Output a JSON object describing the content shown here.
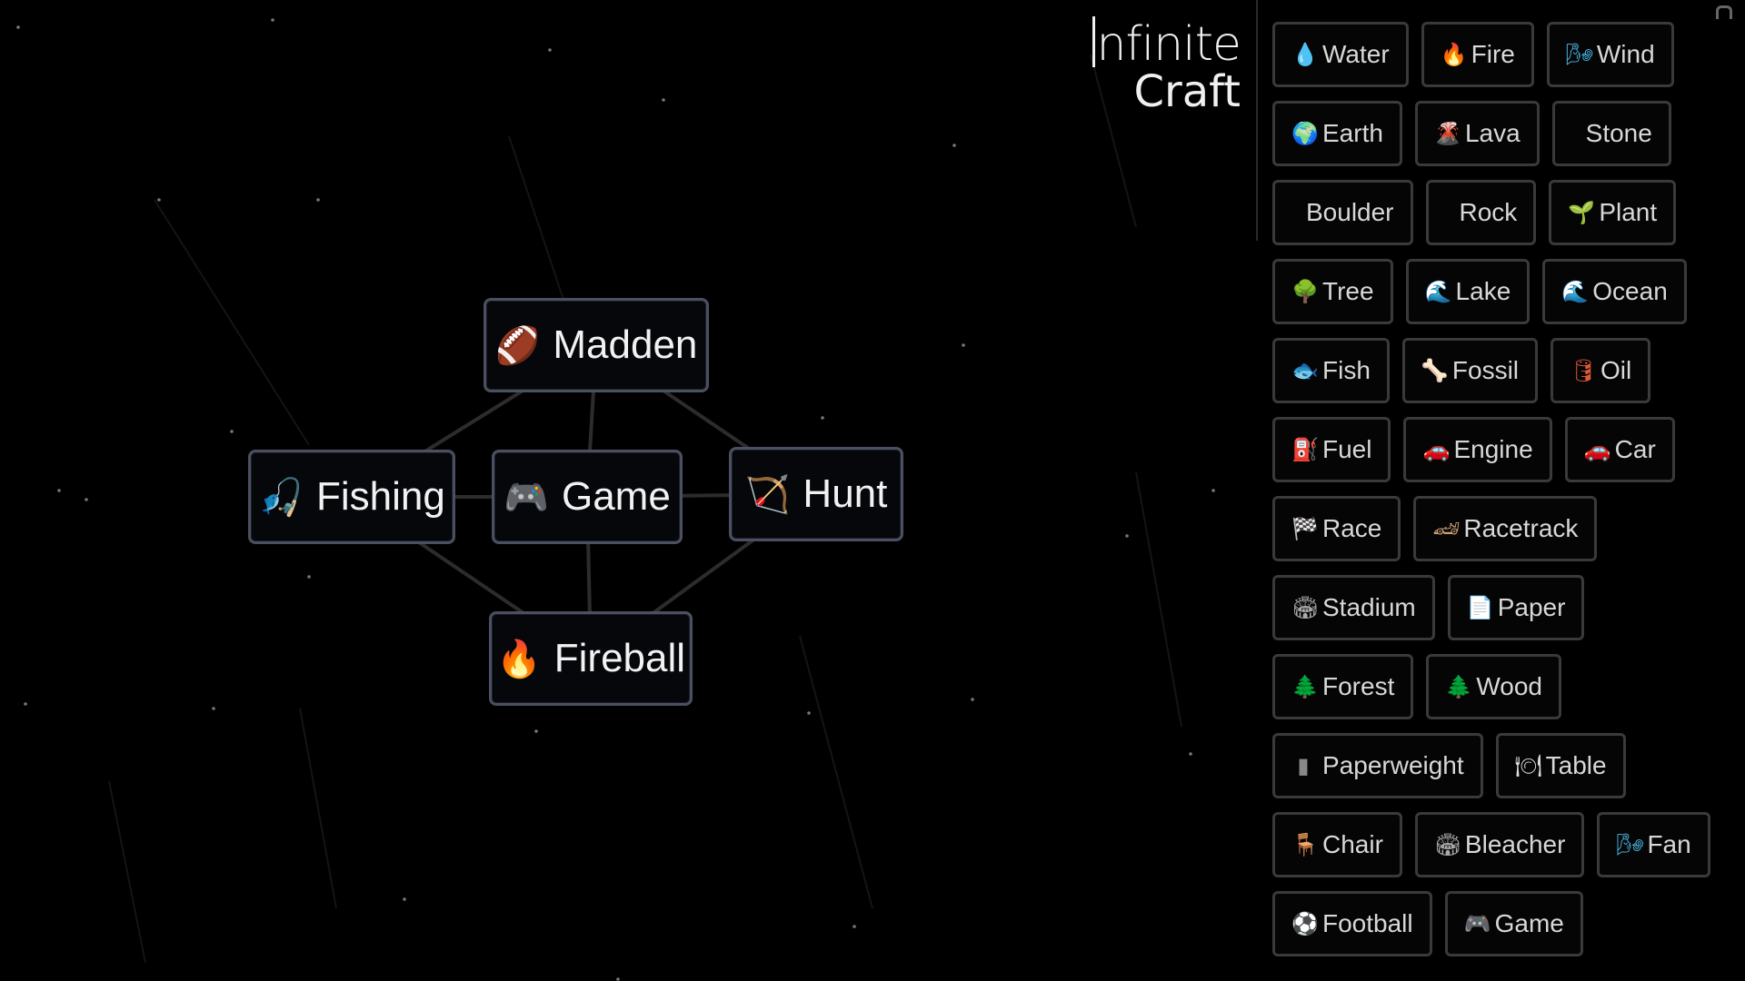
{
  "logo": {
    "line1": "nfinite",
    "line2": "Craft"
  },
  "canvas": {
    "nodes": [
      {
        "id": "madden",
        "label": "Madden",
        "icon": "football-icon",
        "glyph": "🏈",
        "color": "#8a4a24"
      },
      {
        "id": "fishing",
        "label": "Fishing",
        "icon": "fishing-pole-icon",
        "glyph": "🎣",
        "color": "#3aa0e0"
      },
      {
        "id": "game",
        "label": "Game",
        "icon": "gamepad-icon",
        "glyph": "🎮",
        "color": "#555555"
      },
      {
        "id": "hunt",
        "label": "Hunt",
        "icon": "bow-arrow-icon",
        "glyph": "🏹",
        "color": "#b87838"
      },
      {
        "id": "fireball",
        "label": "Fireball",
        "icon": "fire-icon",
        "glyph": "🔥",
        "color": "#f07020"
      }
    ],
    "connections": [
      [
        "madden",
        "fishing"
      ],
      [
        "madden",
        "game"
      ],
      [
        "madden",
        "hunt"
      ],
      [
        "fishing",
        "game"
      ],
      [
        "game",
        "hunt"
      ],
      [
        "fishing",
        "fireball"
      ],
      [
        "game",
        "fireball"
      ],
      [
        "hunt",
        "fireball"
      ]
    ]
  },
  "sidebar": {
    "rows": [
      [
        {
          "label": "Water",
          "icon": "water-drop-icon",
          "glyph": "💧",
          "color": "#3aa8e8"
        },
        {
          "label": "Fire",
          "icon": "fire-icon",
          "glyph": "🔥",
          "color": "#f07020"
        },
        {
          "label": "Wind",
          "icon": "wind-icon",
          "glyph": "🌬",
          "color": "#4ab8e8"
        }
      ],
      [
        {
          "label": "Earth",
          "icon": "globe-icon",
          "glyph": "🌍",
          "color": "#2a9a5a"
        },
        {
          "label": "Lava",
          "icon": "volcano-icon",
          "glyph": "🌋",
          "color": "#c85a3a"
        },
        {
          "label": "Stone",
          "icon": "",
          "glyph": "",
          "color": ""
        }
      ],
      [
        {
          "label": "Boulder",
          "icon": "",
          "glyph": "",
          "color": ""
        },
        {
          "label": "Rock",
          "icon": "",
          "glyph": "",
          "color": ""
        },
        {
          "label": "Plant",
          "icon": "seedling-icon",
          "glyph": "🌱",
          "color": "#8ab040"
        }
      ],
      [
        {
          "label": "Tree",
          "icon": "tree-icon",
          "glyph": "🌳",
          "color": "#2a9a2a"
        },
        {
          "label": "Lake",
          "icon": "wave-icon",
          "glyph": "🌊",
          "color": "#3aa0d0"
        },
        {
          "label": "Ocean",
          "icon": "wave-icon",
          "glyph": "🌊",
          "color": "#3aa0d0"
        }
      ],
      [
        {
          "label": "Fish",
          "icon": "fish-icon",
          "glyph": "🐟",
          "color": "#3aa0e0"
        },
        {
          "label": "Fossil",
          "icon": "bone-icon",
          "glyph": "🦴",
          "color": "#e8e8e8"
        },
        {
          "label": "Oil",
          "icon": "oil-can-icon",
          "glyph": "🛢",
          "color": "#e05a3a"
        }
      ],
      [
        {
          "label": "Fuel",
          "icon": "fuel-pump-icon",
          "glyph": "⛽",
          "color": "#e05a3a"
        },
        {
          "label": "Engine",
          "icon": "car-icon",
          "glyph": "🚗",
          "color": "#c86a5a"
        },
        {
          "label": "Car",
          "icon": "car-icon",
          "glyph": "🚗",
          "color": "#c86a5a"
        }
      ],
      [
        {
          "label": "Race",
          "icon": "flag-icon",
          "glyph": "🏁",
          "color": "#aaaaaa"
        },
        {
          "label": "Racetrack",
          "icon": "racetrack-icon",
          "glyph": "🏎",
          "color": "#c8a070"
        }
      ],
      [
        {
          "label": "Stadium",
          "icon": "stadium-icon",
          "glyph": "🏟",
          "color": "#aaaaaa"
        },
        {
          "label": "Paper",
          "icon": "paper-icon",
          "glyph": "📄",
          "color": "#eeeeee"
        }
      ],
      [
        {
          "label": "Forest",
          "icon": "tree-icon",
          "glyph": "🌲",
          "color": "#2aa02a"
        },
        {
          "label": "Wood",
          "icon": "tree-icon",
          "glyph": "🌲",
          "color": "#2aa02a"
        }
      ],
      [
        {
          "label": "Paperweight",
          "icon": "paperweight-icon",
          "glyph": "▮",
          "color": "#888888"
        },
        {
          "label": "Table",
          "icon": "table-icon",
          "glyph": "🍽",
          "color": "#dddddd"
        }
      ],
      [
        {
          "label": "Chair",
          "icon": "chair-icon",
          "glyph": "🪑",
          "color": "#b08050"
        },
        {
          "label": "Bleacher",
          "icon": "stadium-icon",
          "glyph": "🏟",
          "color": "#aaaaaa"
        },
        {
          "label": "Fan",
          "icon": "fan-icon",
          "glyph": "🌬",
          "color": "#4ab8e8"
        }
      ],
      [
        {
          "label": "Football",
          "icon": "soccer-ball-icon",
          "glyph": "⚽",
          "color": "#ffffff"
        },
        {
          "label": "Game",
          "icon": "gamepad-icon",
          "glyph": "🎮",
          "color": "#555555"
        }
      ]
    ]
  }
}
